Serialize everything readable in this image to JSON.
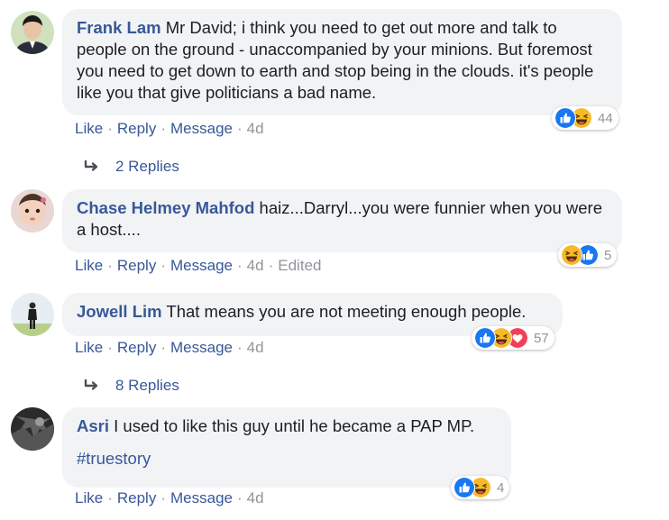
{
  "comments": [
    {
      "author": "Frank Lam",
      "text": "Mr David; i think you need to get out more and talk to people on the ground - unaccompanied by your minions. But foremost you need to get down to earth and stop being in the clouds. it's people like you that give politicians a bad name.",
      "actions": {
        "like": "Like",
        "reply": "Reply",
        "message": "Message",
        "time": "4d"
      },
      "reactions": {
        "icons": [
          "like-icon",
          "haha-icon"
        ],
        "count": "44"
      },
      "replies": "2 Replies"
    },
    {
      "author": "Chase Helmey Mahfod",
      "text": "haiz...Darryl...you were funnier when you were a host....",
      "actions": {
        "like": "Like",
        "reply": "Reply",
        "message": "Message",
        "time": "4d",
        "edited": "Edited"
      },
      "reactions": {
        "icons": [
          "haha-icon",
          "like-icon"
        ],
        "count": "5"
      }
    },
    {
      "author": "Jowell Lim",
      "text": "That means you are not meeting enough people.",
      "actions": {
        "like": "Like",
        "reply": "Reply",
        "message": "Message",
        "time": "4d"
      },
      "reactions": {
        "icons": [
          "like-icon",
          "haha-icon",
          "love-icon"
        ],
        "count": "57"
      },
      "replies": "8 Replies"
    },
    {
      "author": "Asri",
      "text": "I used to like this guy until he became a PAP MP.",
      "hashtag": "#truestory",
      "actions": {
        "like": "Like",
        "reply": "Reply",
        "message": "Message",
        "time": "4d"
      },
      "reactions": {
        "icons": [
          "like-icon",
          "haha-icon"
        ],
        "count": "4"
      }
    }
  ],
  "colors": {
    "link": "#385898",
    "muted": "#90949c",
    "bubble": "#f2f3f5",
    "like": "#1877f2",
    "haha": "#f7b928",
    "love": "#f33e58"
  }
}
